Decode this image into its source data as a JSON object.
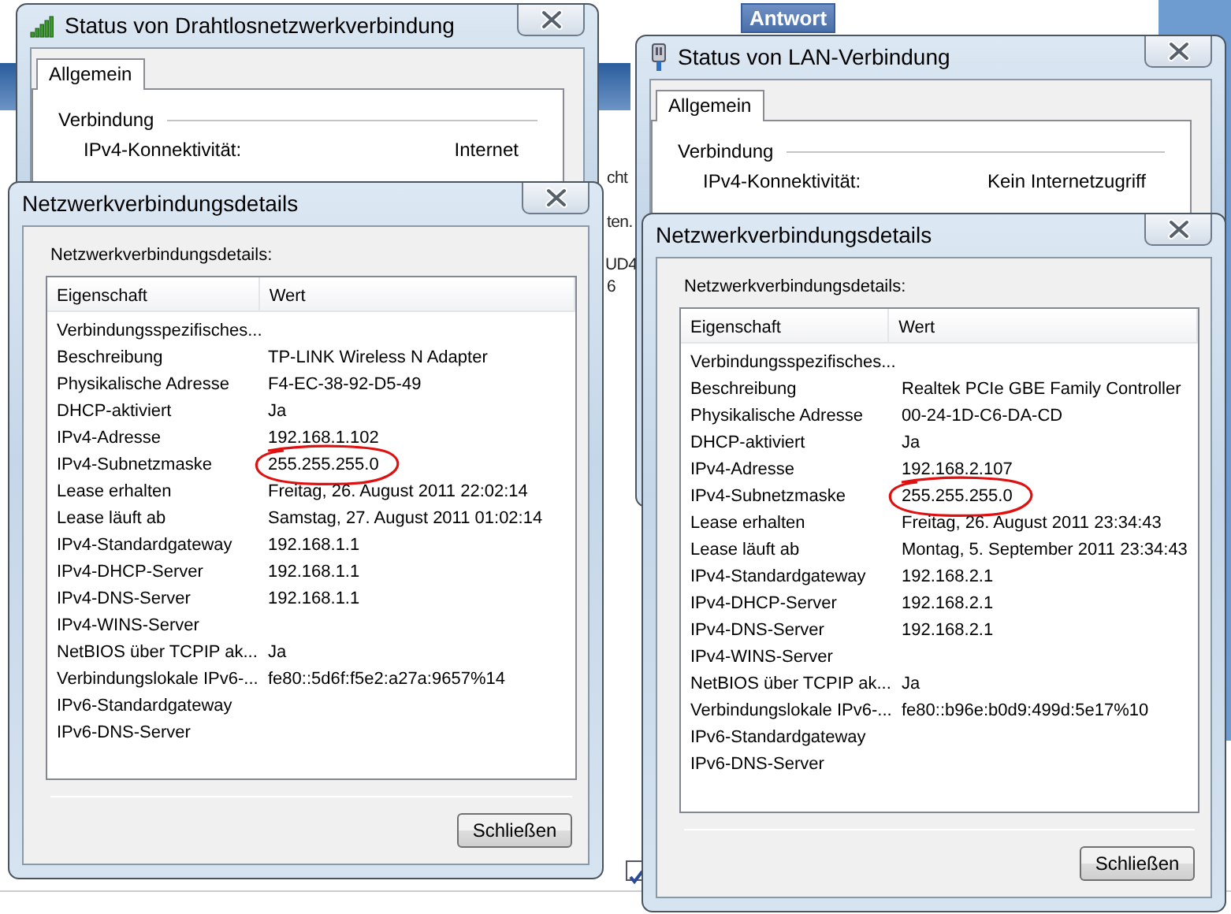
{
  "background": {
    "toolbar_buttons": [
      {
        "label": "Antwort"
      }
    ],
    "fragments": [
      "cht",
      "ten.",
      "UD4",
      "6"
    ],
    "checkbox": {
      "checked": true
    }
  },
  "windows": [
    {
      "kind": "status",
      "title": "Status von Drahtlosnetzwerkverbindung",
      "tabs": [
        {
          "label": "Allgemein",
          "selected": true
        }
      ],
      "group": "Verbindung",
      "rows": [
        {
          "label": "IPv4-Konnektivität:",
          "value": "Internet"
        }
      ]
    },
    {
      "kind": "details",
      "title": "Netzwerkverbindungsdetails",
      "caption": "Netzwerkverbindungsdetails:",
      "columns": [
        "Eigenschaft",
        "Wert"
      ],
      "rows": [
        {
          "property": "Verbindungsspezifisches...",
          "circled": false
        },
        {
          "property": "Beschreibung",
          "value": "TP-LINK Wireless N Adapter",
          "circled": false
        },
        {
          "property": "Physikalische Adresse",
          "value": "F4-EC-38-92-D5-49",
          "circled": false
        },
        {
          "property": "DHCP-aktiviert",
          "value": "Ja",
          "circled": false
        },
        {
          "property": "IPv4-Adresse",
          "value": "192.168.1.102",
          "circled": false
        },
        {
          "property": "IPv4-Subnetzmaske",
          "value": "255.255.255.0",
          "circled": true
        },
        {
          "property": "Lease erhalten",
          "value": "Freitag, 26. August 2011 22:02:14",
          "circled": false
        },
        {
          "property": "Lease läuft ab",
          "value": "Samstag, 27. August 2011 01:02:14",
          "circled": false
        },
        {
          "property": "IPv4-Standardgateway",
          "value": "192.168.1.1",
          "circled": false
        },
        {
          "property": "IPv4-DHCP-Server",
          "value": "192.168.1.1",
          "circled": false
        },
        {
          "property": "IPv4-DNS-Server",
          "value": "192.168.1.1",
          "circled": false
        },
        {
          "property": "IPv4-WINS-Server",
          "circled": false
        },
        {
          "property": "NetBIOS über TCPIP ak...",
          "value": "Ja",
          "circled": false
        },
        {
          "property": "Verbindungslokale IPv6-...",
          "value": "fe80::5d6f:f5e2:a27a:9657%14",
          "circled": false
        },
        {
          "property": "IPv6-Standardgateway",
          "circled": false
        },
        {
          "property": "IPv6-DNS-Server",
          "circled": false
        }
      ],
      "buttons": [
        "Schließen"
      ]
    },
    {
      "kind": "status",
      "title": "Status von LAN-Verbindung",
      "tabs": [
        {
          "label": "Allgemein",
          "selected": true
        }
      ],
      "group": "Verbindung",
      "rows": [
        {
          "label": "IPv4-Konnektivität:",
          "value": "Kein Internetzugriff"
        }
      ]
    },
    {
      "kind": "details",
      "title": "Netzwerkverbindungsdetails",
      "caption": "Netzwerkverbindungsdetails:",
      "columns": [
        "Eigenschaft",
        "Wert"
      ],
      "rows": [
        {
          "property": "Verbindungsspezifisches...",
          "circled": false
        },
        {
          "property": "Beschreibung",
          "value": "Realtek PCIe GBE Family Controller",
          "circled": false
        },
        {
          "property": "Physikalische Adresse",
          "value": "00-24-1D-C6-DA-CD",
          "circled": false
        },
        {
          "property": "DHCP-aktiviert",
          "value": "Ja",
          "circled": false
        },
        {
          "property": "IPv4-Adresse",
          "value": "192.168.2.107",
          "circled": false
        },
        {
          "property": "IPv4-Subnetzmaske",
          "value": "255.255.255.0",
          "circled": true
        },
        {
          "property": "Lease erhalten",
          "value": "Freitag, 26. August 2011 23:34:43",
          "circled": false
        },
        {
          "property": "Lease läuft ab",
          "value": "Montag, 5. September 2011 23:34:43",
          "circled": false
        },
        {
          "property": "IPv4-Standardgateway",
          "value": "192.168.2.1",
          "circled": false
        },
        {
          "property": "IPv4-DHCP-Server",
          "value": "192.168.2.1",
          "circled": false
        },
        {
          "property": "IPv4-DNS-Server",
          "value": "192.168.2.1",
          "circled": false
        },
        {
          "property": "IPv4-WINS-Server",
          "circled": false
        },
        {
          "property": "NetBIOS über TCPIP ak...",
          "value": "Ja",
          "circled": false
        },
        {
          "property": "Verbindungslokale IPv6-...",
          "value": "fe80::b96e:b0d9:499d:5e17%10",
          "circled": false
        },
        {
          "property": "IPv6-Standardgateway",
          "circled": false
        },
        {
          "property": "IPv6-DNS-Server",
          "circled": false
        }
      ],
      "buttons": [
        "Schließen"
      ]
    }
  ]
}
